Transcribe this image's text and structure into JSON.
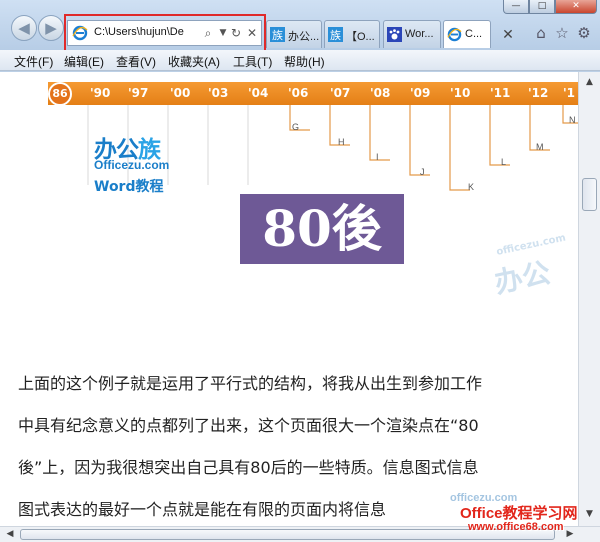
{
  "browser": {
    "address": "C:\\Users\\hujun\\De",
    "tabs": [
      {
        "label": "办公..."
      },
      {
        "label": "【O..."
      },
      {
        "label": "Wor..."
      },
      {
        "label": "C..."
      }
    ],
    "controls": {
      "minimize": "—",
      "maximize": "□",
      "close": "✕"
    },
    "icons": [
      "back-arrow",
      "forward-arrow",
      "ie-page-icon",
      "search-icon",
      "dropdown-icon",
      "refresh-icon",
      "stop-icon",
      "home-icon",
      "favorites-star-icon",
      "gear-icon"
    ]
  },
  "menu": {
    "items": [
      {
        "label": "文件(F)"
      },
      {
        "label": "编辑(E)"
      },
      {
        "label": "查看(V)"
      },
      {
        "label": "收藏夹(A)"
      },
      {
        "label": "工具(T)"
      },
      {
        "label": "帮助(H)"
      }
    ]
  },
  "page": {
    "timeline": {
      "start": "86",
      "years": [
        "'90",
        "'97",
        "'00",
        "'03",
        "'04",
        "'06",
        "'07",
        "'08",
        "'09",
        "'10",
        "'11",
        "'12",
        "'1"
      ],
      "letters": [
        "G",
        "H",
        "I",
        "J",
        "K",
        "L",
        "M",
        "N"
      ]
    },
    "logo": {
      "cn": "办公",
      "cn_accent": "族",
      "en": "Officezu.com",
      "word": "Word教程"
    },
    "hero_text": "80後",
    "watermark": {
      "small": "officezu.com",
      "big": "办公"
    },
    "paragraph_lines": [
      "上面的这个例子就是运用了平行式的结构，将我从出生到参加工作",
      "中具有纪念意义的点都列了出来，这个页面很大一个渲染点在“80",
      "後”上，因为我很想突出自己具有80后的一些特质。信息图式信息",
      "图式表达的最好一个点就是能在有限的页面内将信息"
    ]
  },
  "site_watermark": {
    "top": "officezu.com",
    "brand": "Office教程学习网",
    "url": "www.office68.com"
  },
  "colors": {
    "highlight_box": "#e02a2a",
    "timeline_orange": "#e47f16",
    "hero_purple": "#6e5996",
    "logo_blue": "#1a7ec9",
    "brand_red": "#e2261b"
  }
}
